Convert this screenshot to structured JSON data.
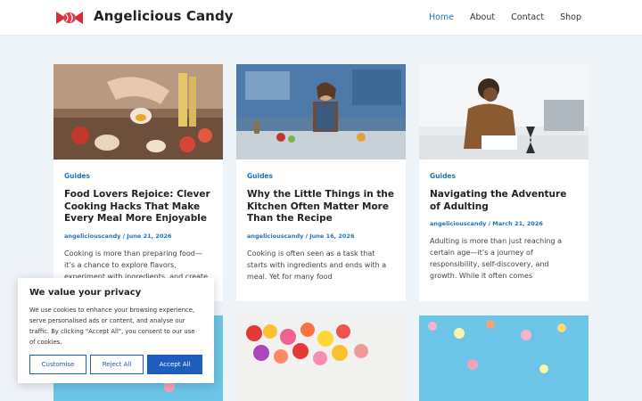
{
  "header": {
    "site_title": "Angelicious Candy",
    "nav": [
      {
        "label": "Home",
        "active": true
      },
      {
        "label": "About",
        "active": false
      },
      {
        "label": "Contact",
        "active": false
      },
      {
        "label": "Shop",
        "active": false
      }
    ]
  },
  "posts": [
    {
      "category": "Guides",
      "title": "Food Lovers Rejoice: Clever Cooking Hacks That Make Every Meal More Enjoyable",
      "author": "angeliciouscandy",
      "date": "June 21, 2026",
      "excerpt": "Cooking is more than preparing food—it’s a chance to explore flavors, experiment with ingredients, and create"
    },
    {
      "category": "Guides",
      "title": "Why the Little Things in the Kitchen Often Matter More Than the Recipe",
      "author": "angeliciouscandy",
      "date": "June 16, 2026",
      "excerpt": "Cooking is often seen as a task that starts with ingredients and ends with a meal. Yet for many food"
    },
    {
      "category": "Guides",
      "title": "Navigating the Adventure of Adulting",
      "author": "angeliciouscandy",
      "date": "March 21, 2026",
      "excerpt": "Adulting is more than just reaching a certain age—it’s a journey of responsibility, self-discovery, and growth. While it often comes"
    }
  ],
  "cookie": {
    "title": "We value your privacy",
    "text": "We use cookies to enhance your browsing experience, serve personalised ads or content, and analyse our traffic. By clicking \"Accept All\", you consent to our use of cookies.",
    "customise_label": "Customise",
    "reject_label": "Reject All",
    "accept_label": "Accept All"
  },
  "colors": {
    "accent": "#1e73be",
    "button": "#1e5cc0",
    "background": "#eef3f8"
  }
}
